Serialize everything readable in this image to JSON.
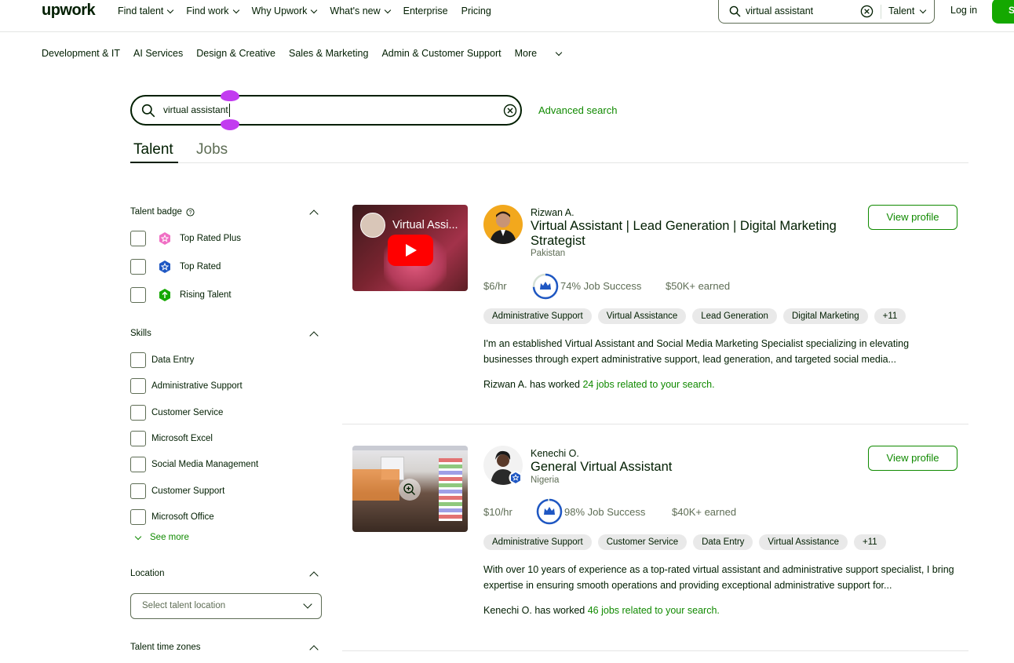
{
  "nav": {
    "logo": "upwork",
    "links": [
      "Find talent",
      "Find work",
      "Why Upwork",
      "What's new",
      "Enterprise",
      "Pricing"
    ],
    "search_value": "virtual assistant",
    "search_scope": "Talent",
    "login": "Log in",
    "signup": "S"
  },
  "categories": [
    "Development & IT",
    "AI Services",
    "Design & Creative",
    "Sales & Marketing",
    "Admin & Customer Support",
    "More"
  ],
  "search": {
    "value": "virtual assistant",
    "advanced": "Advanced search"
  },
  "tabs": {
    "talent": "Talent",
    "jobs": "Jobs"
  },
  "filters": {
    "talent_badge": {
      "title": "Talent badge",
      "options": [
        "Top Rated Plus",
        "Top Rated",
        "Rising Talent"
      ]
    },
    "skills": {
      "title": "Skills",
      "options": [
        "Data Entry",
        "Administrative Support",
        "Customer Service",
        "Microsoft Excel",
        "Social Media Management",
        "Customer Support",
        "Microsoft Office"
      ],
      "see_more": "See more"
    },
    "location": {
      "title": "Location",
      "placeholder": "Select talent location"
    },
    "time_zones": {
      "title": "Talent time zones"
    }
  },
  "freelancers": [
    {
      "name": "Rizwan A.",
      "title": "Virtual Assistant | Lead Generation | Digital Marketing Strategist",
      "country": "Pakistan",
      "video_title": "Virtual Assi...",
      "view_profile": "View profile",
      "rate": "$6/hr",
      "job_success": "74% Job Success",
      "job_success_value": 0.74,
      "earned": "$50K+ earned",
      "skills": [
        "Administrative Support",
        "Virtual Assistance",
        "Lead Generation",
        "Digital Marketing",
        "+11"
      ],
      "description": "I'm an established Virtual Assistant and Social Media Marketing Specialist specializing in elevating businesses through expert administrative support, lead generation, and targeted social media...",
      "worked_prefix": "Rizwan A. has worked ",
      "worked_link": "24 jobs related to your search."
    },
    {
      "name": "Kenechi O.",
      "title": "General Virtual Assistant",
      "country": "Nigeria",
      "view_profile": "View profile",
      "rate": "$10/hr",
      "job_success": "98% Job Success",
      "job_success_value": 0.98,
      "earned": "$40K+ earned",
      "skills": [
        "Administrative Support",
        "Customer Service",
        "Data Entry",
        "Virtual Assistance",
        "+11"
      ],
      "description": "With over 10 years of experience as a top-rated virtual assistant and administrative support specialist, I bring expertise in ensuring smooth operations and providing exceptional administrative support for...",
      "worked_prefix": "Kenechi O. has worked ",
      "worked_link": "46 jobs related to your search."
    }
  ],
  "colors": {
    "brand": "#14a800",
    "link": "#108a00",
    "text": "#001e00",
    "muted": "#5e6d55",
    "badge_blue": "#1f57c3"
  }
}
